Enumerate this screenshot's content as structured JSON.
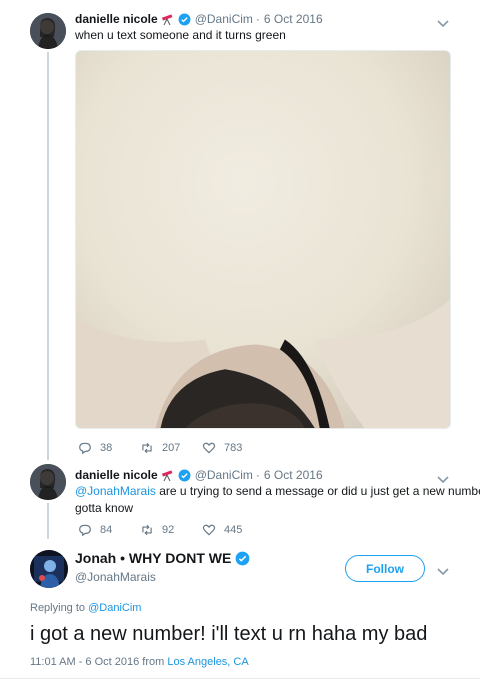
{
  "tweet1": {
    "name": "danielle nicole",
    "handle": "@DaniCim",
    "separator": "·",
    "date": "6 Oct 2016",
    "text": "when u text someone and it turns green",
    "replies": "38",
    "retweets": "207",
    "likes": "783",
    "emoji_icon": "telescope-icon"
  },
  "tweet2": {
    "name": "danielle nicole",
    "handle": "@DaniCim",
    "separator": "·",
    "date": "6 Oct 2016",
    "mention": "@JonahMarais",
    "text_line1_rest": " are u trying to send a message or did u just get a new number I",
    "text_line2": "gotta know",
    "replies": "84",
    "retweets": "92",
    "likes": "445"
  },
  "main_tweet": {
    "name": "Jonah • WHY DONT WE",
    "handle": "@JonahMarais",
    "follow_label": "Follow",
    "replying_prefix": "Replying to ",
    "replying_to": "@DaniCim",
    "text": "i got a new number! i'll text u rn haha my bad",
    "time_date": "11:01 AM - 6 Oct 2016 from ",
    "location": "Los Angeles, CA"
  },
  "colors": {
    "accent": "#1da1f2",
    "link": "#1b95e0",
    "muted": "#657786",
    "border": "#e6ecf0"
  }
}
